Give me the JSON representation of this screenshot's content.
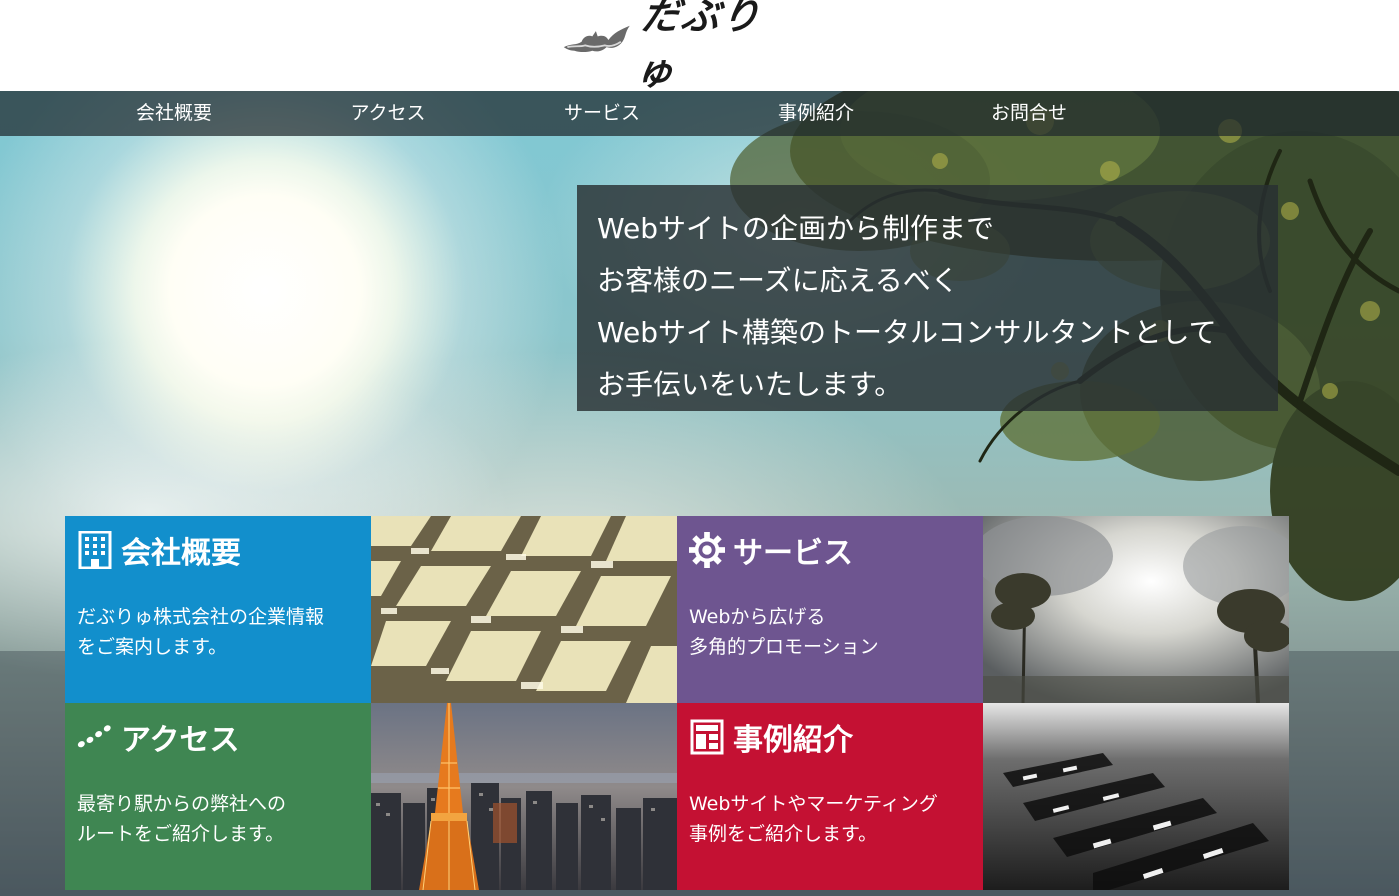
{
  "site": {
    "logo_text": "だぶりゅ"
  },
  "nav": {
    "items": [
      {
        "label": "会社概要"
      },
      {
        "label": "アクセス"
      },
      {
        "label": "サービス"
      },
      {
        "label": "事例紹介"
      },
      {
        "label": "お問合せ"
      }
    ]
  },
  "hero": {
    "tagline": [
      "Webサイトの企画から制作まで",
      "お客様のニーズに応えるべく",
      "Webサイト構築のトータルコンサルタントとして",
      "お手伝いをいたします。"
    ]
  },
  "tiles": {
    "company": {
      "title": "会社概要",
      "desc1": "だぶりゅ株式会社の企業情報",
      "desc2": "をご案内します。",
      "icon": "building-icon",
      "color": "#128fcc"
    },
    "service": {
      "title": "サービス",
      "desc1": "Webから広げる",
      "desc2": "多角的プロモーション",
      "icon": "gear-icon",
      "color": "#6e5590"
    },
    "access": {
      "title": "アクセス",
      "desc1": "最寄り駅からの弊社への",
      "desc2": "ルートをご紹介します。",
      "icon": "footprints-icon",
      "color": "#3f8652"
    },
    "cases": {
      "title": "事例紹介",
      "desc1": "Webサイトやマーケティング",
      "desc2": "事例をご紹介します。",
      "icon": "layout-icon",
      "color": "#c41133"
    }
  }
}
